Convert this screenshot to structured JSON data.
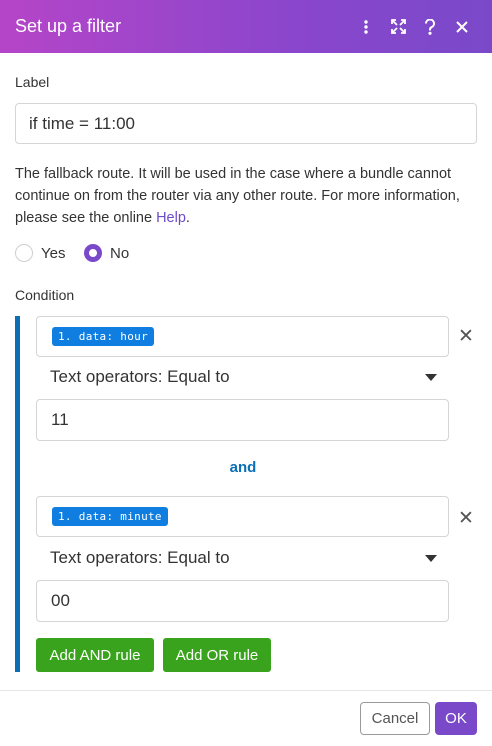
{
  "dialog": {
    "title": "Set up a filter",
    "header_icons": [
      "more-vertical-icon",
      "expand-icon",
      "help-icon",
      "close-icon"
    ]
  },
  "label_field": {
    "label": "Label",
    "value": "if time = 11:00"
  },
  "fallback": {
    "text": "The fallback route. It will be used in the case where a bundle cannot continue on from the router via any other route. For more information, please see the online ",
    "link": "Help",
    "after_link": ".",
    "options": [
      {
        "label": "Yes",
        "checked": false
      },
      {
        "label": "No",
        "checked": true
      }
    ]
  },
  "condition": {
    "label": "Condition",
    "joiner": "and",
    "rules": [
      {
        "field_pill": "1. data: hour",
        "operator": "Text operators: Equal to",
        "value": "11"
      },
      {
        "field_pill": "1. data: minute",
        "operator": "Text operators: Equal to",
        "value": "00"
      }
    ],
    "add_and": "Add AND rule",
    "add_or": "Add OR rule"
  },
  "footer": {
    "cancel": "Cancel",
    "ok": "OK"
  },
  "colors": {
    "header_start": "#b545c8",
    "header_end": "#7a49c9",
    "accent": "#7a49c9",
    "rule_bar": "#0a6fb5",
    "pill": "#0f7ee0",
    "green_button": "#3aa31d"
  }
}
